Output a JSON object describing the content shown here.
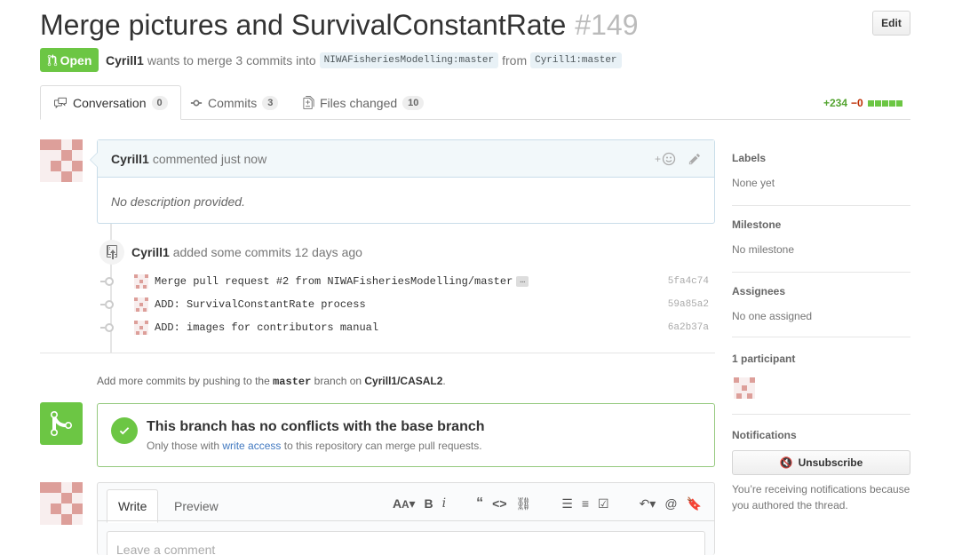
{
  "pr": {
    "title": "Merge pictures and SurvivalConstantRate",
    "number": "#149",
    "edit_label": "Edit",
    "state": "Open",
    "author": "Cyrill1",
    "meta_text": "wants to merge 3 commits into",
    "base_ref": "NIWAFisheriesModelling:master",
    "from_text": "from",
    "head_ref": "Cyrill1:master"
  },
  "tabs": [
    {
      "label": "Conversation",
      "count": "0"
    },
    {
      "label": "Commits",
      "count": "3"
    },
    {
      "label": "Files changed",
      "count": "10"
    }
  ],
  "diffstat": {
    "additions": "+234",
    "deletions": "−0"
  },
  "comment": {
    "author": "Cyrill1",
    "action": "commented just now",
    "body": "No description provided."
  },
  "push_event": {
    "author": "Cyrill1",
    "text": "added some commits 12 days ago"
  },
  "commits": [
    {
      "message": "Merge pull request #2 from NIWAFisheriesModelling/master",
      "ellipsis": "…",
      "sha": "5fa4c74"
    },
    {
      "message": "ADD: SurvivalConstantRate process",
      "ellipsis": "",
      "sha": "59a85a2"
    },
    {
      "message": "ADD: images for contributors manual",
      "ellipsis": "",
      "sha": "6a2b37a"
    }
  ],
  "hint": {
    "prefix": "Add more commits by pushing to the",
    "branch": "master",
    "middle": "branch on",
    "repo": "Cyrill1/CASAL2",
    "suffix": "."
  },
  "merge": {
    "title": "This branch has no conflicts with the base branch",
    "sub_prefix": "Only those with",
    "sub_link": "write access",
    "sub_suffix": "to this repository can merge pull requests."
  },
  "composer": {
    "write_tab": "Write",
    "preview_tab": "Preview",
    "placeholder": "Leave a comment"
  },
  "sidebar": {
    "labels_h": "Labels",
    "labels_v": "None yet",
    "milestone_h": "Milestone",
    "milestone_v": "No milestone",
    "assignees_h": "Assignees",
    "assignees_v": "No one assigned",
    "participants_h": "1 participant",
    "notifications_h": "Notifications",
    "unsubscribe": "Unsubscribe",
    "notif_text": "You’re receiving notifications because you authored the thread."
  },
  "colors": {
    "open_green": "#6cc644",
    "link_blue": "#4078c0",
    "deletion_red": "#bd2c00"
  }
}
